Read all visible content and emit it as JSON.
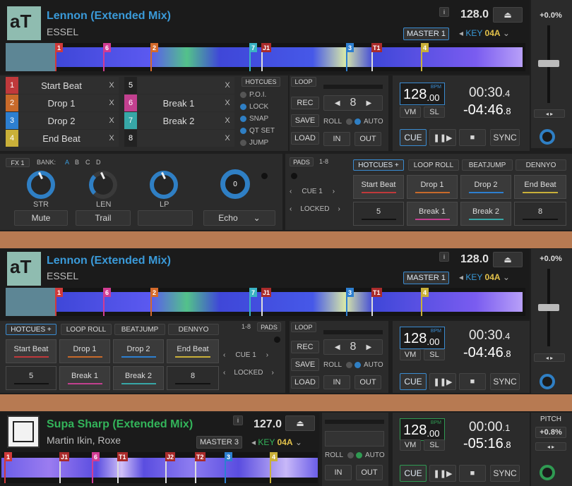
{
  "deck1": {
    "title": "Lennon (Extended Mix)",
    "artist": "ESSEL",
    "bpm_display": "128.0",
    "master_label": "MASTER 1",
    "key_label": "KEY",
    "key_value": "04A",
    "pitch": "+0.0%",
    "info": "i",
    "markers": [
      "1",
      "6",
      "2",
      "7",
      "J1",
      "3",
      "T1",
      "4"
    ],
    "hotcues": [
      {
        "num": "1",
        "name": "Start Beat",
        "x": "X",
        "color": "#c0393b"
      },
      {
        "num": "2",
        "name": "Drop 1",
        "x": "X",
        "color": "#c86a2a"
      },
      {
        "num": "3",
        "name": "Drop 2",
        "x": "X",
        "color": "#2d7fd0"
      },
      {
        "num": "4",
        "name": "End Beat",
        "x": "X",
        "color": "#c9b039"
      },
      {
        "num": "5",
        "name": "",
        "x": "X",
        "color": "#222"
      },
      {
        "num": "6",
        "name": "Break 1",
        "x": "X",
        "color": "#c2408f"
      },
      {
        "num": "7",
        "name": "Break 2",
        "x": "X",
        "color": "#37a7a7"
      },
      {
        "num": "8",
        "name": "",
        "x": "X",
        "color": "#222"
      }
    ],
    "hotcue_menu": {
      "title": "HOTCUES",
      "items": [
        "P.O.I.",
        "LOCK",
        "SNAP",
        "QT SET",
        "JUMP"
      ]
    },
    "loop": {
      "title": "LOOP",
      "rec": "REC",
      "save": "SAVE",
      "load": "LOAD",
      "size": "8",
      "roll": "ROLL",
      "auto": "AUTO",
      "in": "IN",
      "out": "OUT"
    },
    "bpm": {
      "int": "128",
      "dec": ".00",
      "unit": "BPM",
      "vm": "VM",
      "sl": "SL"
    },
    "time": {
      "elapsed": "00:30",
      "elapsed_dec": ".4",
      "remain": "-04:46",
      "remain_dec": ".8"
    },
    "transport": {
      "cue": "CUE",
      "sync": "SYNC"
    },
    "fx": {
      "title": "FX 1",
      "bank": "BANK:",
      "banks": [
        "A",
        "B",
        "C",
        "D"
      ],
      "knobs": [
        "STR",
        "LEN",
        "LP"
      ],
      "buttons": [
        "Mute",
        "Trail",
        ""
      ],
      "effect": "Echo",
      "main_value": "0"
    },
    "pads": {
      "title": "PADS",
      "page": "1-8",
      "tabs": [
        "HOTCUES +",
        "LOOP ROLL",
        "BEATJUMP",
        "DENNYO"
      ],
      "cue_label": "CUE 1",
      "lock_label": "LOCKED",
      "items": [
        {
          "label": "Start Beat",
          "color": "#c0393b"
        },
        {
          "label": "Drop 1",
          "color": "#c86a2a"
        },
        {
          "label": "Drop 2",
          "color": "#2d7fd0"
        },
        {
          "label": "End Beat",
          "color": "#c9b039"
        },
        {
          "label": "5",
          "color": "#222"
        },
        {
          "label": "Break 1",
          "color": "#c2408f"
        },
        {
          "label": "Break 2",
          "color": "#37a7a7"
        },
        {
          "label": "8",
          "color": "#222"
        }
      ]
    }
  },
  "deck2": {
    "title": "Lennon (Extended Mix)",
    "artist": "ESSEL",
    "bpm_display": "128.0",
    "master_label": "MASTER 1",
    "key_label": "KEY",
    "key_value": "04A",
    "pitch": "+0.0%",
    "info": "i",
    "markers": [
      "1",
      "6",
      "2",
      "7",
      "J1",
      "3",
      "T1",
      "4"
    ],
    "pads": {
      "title": "PADS",
      "page": "1-8",
      "tabs": [
        "HOTCUES +",
        "LOOP ROLL",
        "BEATJUMP",
        "DENNYO"
      ],
      "cue_label": "CUE 1",
      "lock_label": "LOCKED",
      "items": [
        {
          "label": "Start Beat",
          "color": "#c0393b"
        },
        {
          "label": "Drop 1",
          "color": "#c86a2a"
        },
        {
          "label": "Drop 2",
          "color": "#2d7fd0"
        },
        {
          "label": "End Beat",
          "color": "#c9b039"
        },
        {
          "label": "5",
          "color": "#222"
        },
        {
          "label": "Break 1",
          "color": "#c2408f"
        },
        {
          "label": "Break 2",
          "color": "#37a7a7"
        },
        {
          "label": "8",
          "color": "#222"
        }
      ]
    },
    "loop": {
      "title": "LOOP",
      "rec": "REC",
      "save": "SAVE",
      "load": "LOAD",
      "size": "8",
      "roll": "ROLL",
      "auto": "AUTO",
      "in": "IN",
      "out": "OUT"
    },
    "bpm": {
      "int": "128",
      "dec": ".00",
      "unit": "BPM",
      "vm": "VM",
      "sl": "SL"
    },
    "time": {
      "elapsed": "00:30",
      "elapsed_dec": ".4",
      "remain": "-04:46",
      "remain_dec": ".8"
    },
    "transport": {
      "cue": "CUE",
      "sync": "SYNC"
    }
  },
  "deck3": {
    "title": "Supa Sharp (Extended Mix)",
    "artist": "Martin Ikin, Roxe",
    "bpm_display": "127.0",
    "master_label": "MASTER 3",
    "key_label": "KEY",
    "key_value": "04A",
    "pitch_label": "PITCH",
    "pitch": "+0.8%",
    "info": "i",
    "markers": [
      "1",
      "J1",
      "6",
      "T1",
      "J2",
      "T2",
      "3",
      "4"
    ],
    "loop": {
      "roll": "ROLL",
      "auto": "AUTO",
      "in": "IN",
      "out": "OUT"
    },
    "bpm": {
      "int": "128",
      "dec": ".00",
      "unit": "BPM",
      "vm": "VM",
      "sl": "SL"
    },
    "time": {
      "elapsed": "00:00",
      "elapsed_dec": ".1",
      "remain": "-05:16",
      "remain_dec": ".8"
    },
    "transport": {
      "cue": "CUE",
      "sync": "SYNC"
    }
  },
  "colors": {
    "accent_blue": "#3a8bd0",
    "accent_green": "#2f9a52",
    "separator": "#b77a52"
  }
}
